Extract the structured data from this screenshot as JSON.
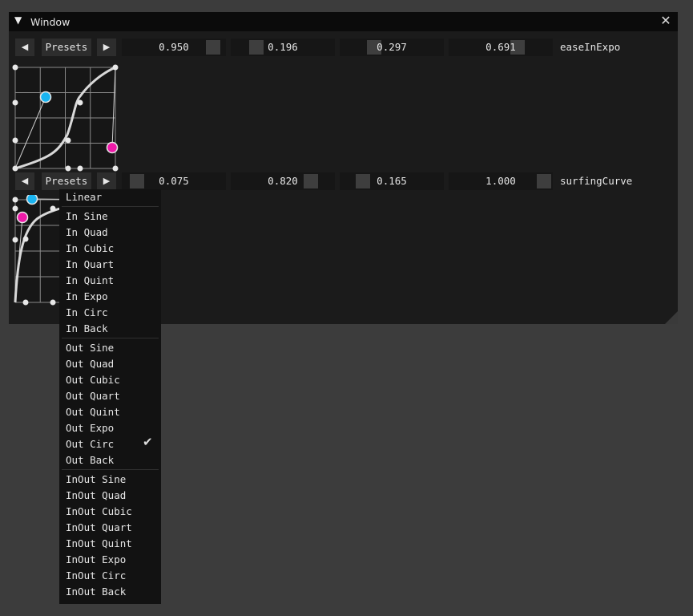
{
  "window": {
    "title": "Window",
    "collapse_icon": "triangle-down-icon",
    "close_icon": "close-icon"
  },
  "editors": [
    {
      "prev_icon": "arrow-left-icon",
      "presets_label": "Presets",
      "next_icon": "arrow-right-icon",
      "values": [
        {
          "text": "0.950",
          "value": 0.95
        },
        {
          "text": "0.196",
          "value": 0.196
        },
        {
          "text": "0.297",
          "value": 0.297
        },
        {
          "text": "0.691",
          "value": 0.691
        }
      ],
      "label": "easeInExpo"
    },
    {
      "prev_icon": "arrow-left-icon",
      "presets_label": "Presets",
      "next_icon": "arrow-right-icon",
      "values": [
        {
          "text": "0.075",
          "value": 0.075
        },
        {
          "text": "0.820",
          "value": 0.82
        },
        {
          "text": "0.165",
          "value": 0.165
        },
        {
          "text": "1.000",
          "value": 1.0
        }
      ],
      "label": "surfingCurve"
    }
  ],
  "colors": {
    "handle_a": "#1ab4f0",
    "handle_b": "#ee1aa8",
    "curve": "#d8d8d8",
    "window_bg": "#1b1b1b",
    "title_bg": "#0b0b0b",
    "frame_bg": "#161616",
    "button_bg": "#2d2d2d"
  },
  "presets_menu": {
    "groups": [
      [
        "Linear"
      ],
      [
        "In Sine",
        "In Quad",
        "In Cubic",
        "In Quart",
        "In Quint",
        "In Expo",
        "In Circ",
        "In Back"
      ],
      [
        "Out Sine",
        "Out Quad",
        "Out Cubic",
        "Out Quart",
        "Out Quint",
        "Out Expo",
        "Out Circ",
        "Out Back"
      ],
      [
        "InOut Sine",
        "InOut Quad",
        "InOut Cubic",
        "InOut Quart",
        "InOut Quint",
        "InOut Expo",
        "InOut Circ",
        "InOut Back"
      ]
    ],
    "selected": "Out Circ",
    "check_icon": "checkmark-icon"
  }
}
